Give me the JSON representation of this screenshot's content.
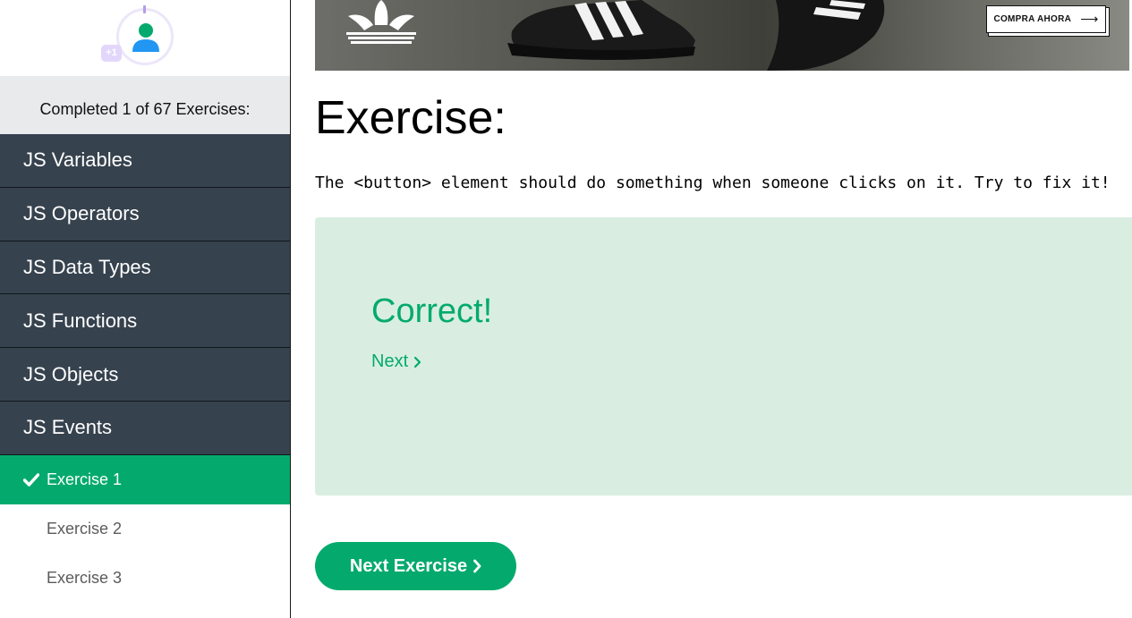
{
  "sidebar": {
    "badge": "+1",
    "progress_text": "Completed 1 of 67 Exercises:",
    "nav_items": [
      {
        "label": "JS Variables"
      },
      {
        "label": "JS Operators"
      },
      {
        "label": "JS Data Types"
      },
      {
        "label": "JS Functions"
      },
      {
        "label": "JS Objects"
      },
      {
        "label": "JS Events"
      }
    ],
    "exercises": [
      {
        "label": "Exercise 1",
        "completed": true
      },
      {
        "label": "Exercise 2",
        "completed": false
      },
      {
        "label": "Exercise 3",
        "completed": false
      }
    ]
  },
  "banner": {
    "cta_label": "COMPRA AHORA",
    "cta_icon": "arrow-right-icon",
    "logo_icon": "adidas-trefoil-logo"
  },
  "exercise": {
    "title": "Exercise:",
    "instruction": "The <button> element should do something when someone clicks on it. Try to fix it!"
  },
  "result": {
    "message": "Correct!",
    "next_label": "Next"
  },
  "next_exercise_button": "Next Exercise",
  "colors": {
    "accent": "#04aa6d",
    "nav_bg": "#36424e",
    "result_bg": "#d9eee1"
  }
}
